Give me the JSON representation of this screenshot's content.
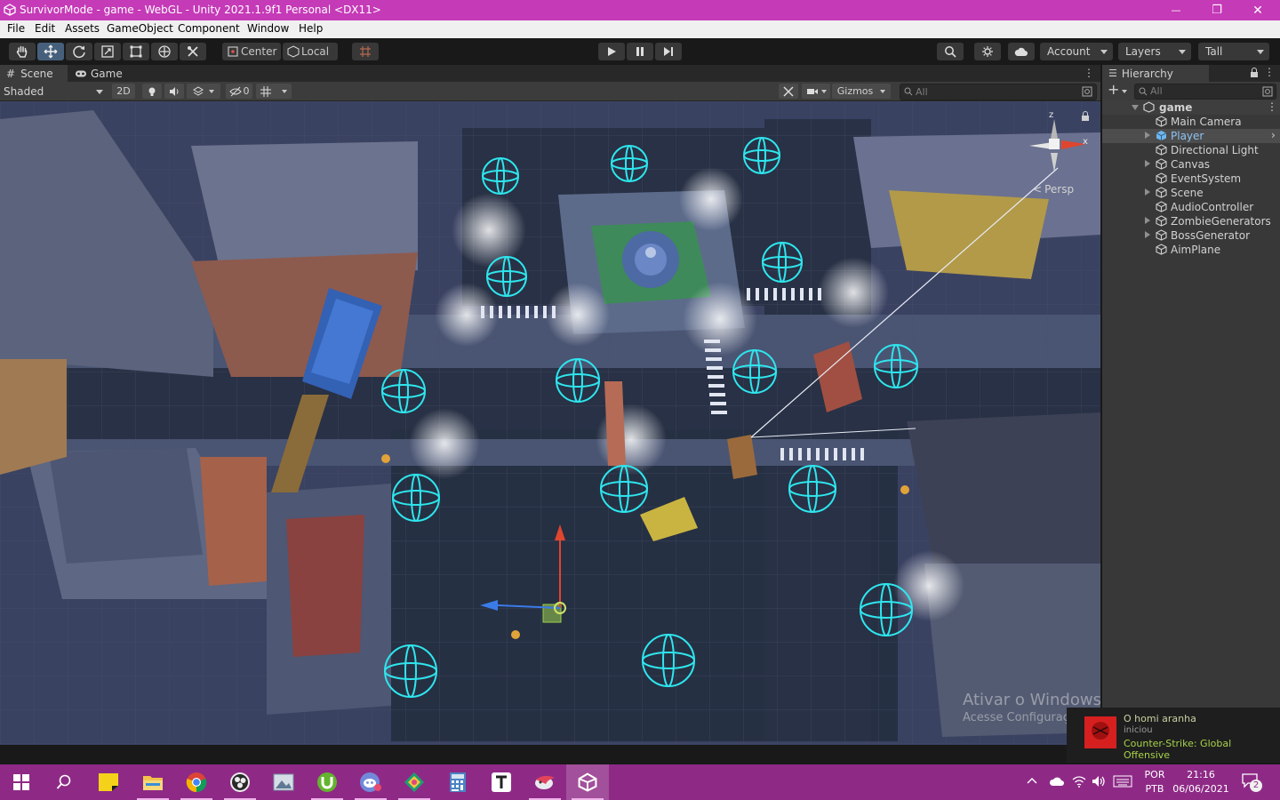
{
  "window": {
    "title": "SurvivorMode - game - WebGL - Unity 2021.1.9f1 Personal <DX11>",
    "controls": {
      "minimize": "—",
      "maximize": "❐",
      "close": "✕"
    }
  },
  "menu": [
    "File",
    "Edit",
    "Assets",
    "GameObject",
    "Component",
    "Window",
    "Help"
  ],
  "toolbar": {
    "tools": [
      "hand-tool",
      "move-tool",
      "rotate-tool",
      "scale-tool",
      "rect-tool",
      "transform-tool",
      "custom-tool"
    ],
    "active_tool": "move-tool",
    "pivot_mode": "Center",
    "pivot_rotation": "Local",
    "play_controls": [
      "play",
      "pause",
      "step"
    ],
    "account": "Account",
    "layers": "Layers",
    "layout": "Tall"
  },
  "scene_view": {
    "tabs": [
      "Scene",
      "Game"
    ],
    "active_tab": "Scene",
    "draw_mode": "Shaded",
    "mode_2d": "2D",
    "hidden_count": "0",
    "gizmos": "Gizmos",
    "search_placeholder": "All",
    "projection": "Persp",
    "axes": {
      "z": "z",
      "x": "x"
    },
    "overlay": {
      "activate_title": "Ativar o Windows",
      "activate_sub": "Acesse Configurações para ativar o Windows."
    }
  },
  "hierarchy": {
    "tab": "Hierarchy",
    "search_placeholder": "All",
    "add_label": "+",
    "scene_name": "game",
    "items": [
      {
        "name": "Main Camera",
        "expandable": false,
        "selected": false
      },
      {
        "name": "Player",
        "expandable": true,
        "selected": true,
        "prefab": true
      },
      {
        "name": "Directional Light",
        "expandable": false,
        "selected": false
      },
      {
        "name": "Canvas",
        "expandable": true,
        "selected": false
      },
      {
        "name": "EventSystem",
        "expandable": false,
        "selected": false
      },
      {
        "name": "Scene",
        "expandable": true,
        "selected": false
      },
      {
        "name": "AudioController",
        "expandable": false,
        "selected": false
      },
      {
        "name": "ZombieGenerators",
        "expandable": true,
        "selected": false
      },
      {
        "name": "BossGenerator",
        "expandable": true,
        "selected": false
      },
      {
        "name": "AimPlane",
        "expandable": false,
        "selected": false
      }
    ]
  },
  "notification": {
    "user": "O homi aranha",
    "action": "iniciou",
    "game": "Counter-Strike: Global Offensive"
  },
  "taskbar": {
    "apps": [
      "start",
      "search",
      "sticky-notes",
      "file-explorer",
      "chrome",
      "obs",
      "photos",
      "utorrent",
      "discord",
      "gitkraken",
      "calculator",
      "typora",
      "app-bird",
      "unity"
    ],
    "tray": {
      "language": "POR",
      "layout": "PTB",
      "time": "21:16",
      "date": "06/06/2021",
      "notifications": "2"
    }
  },
  "colors": {
    "titlebar": "#c53ab7",
    "taskbar": "#8e2a86",
    "editor_bg": "#191919",
    "panel": "#383838",
    "gizmo": "#2ee6ee",
    "accent": "#46607c"
  }
}
